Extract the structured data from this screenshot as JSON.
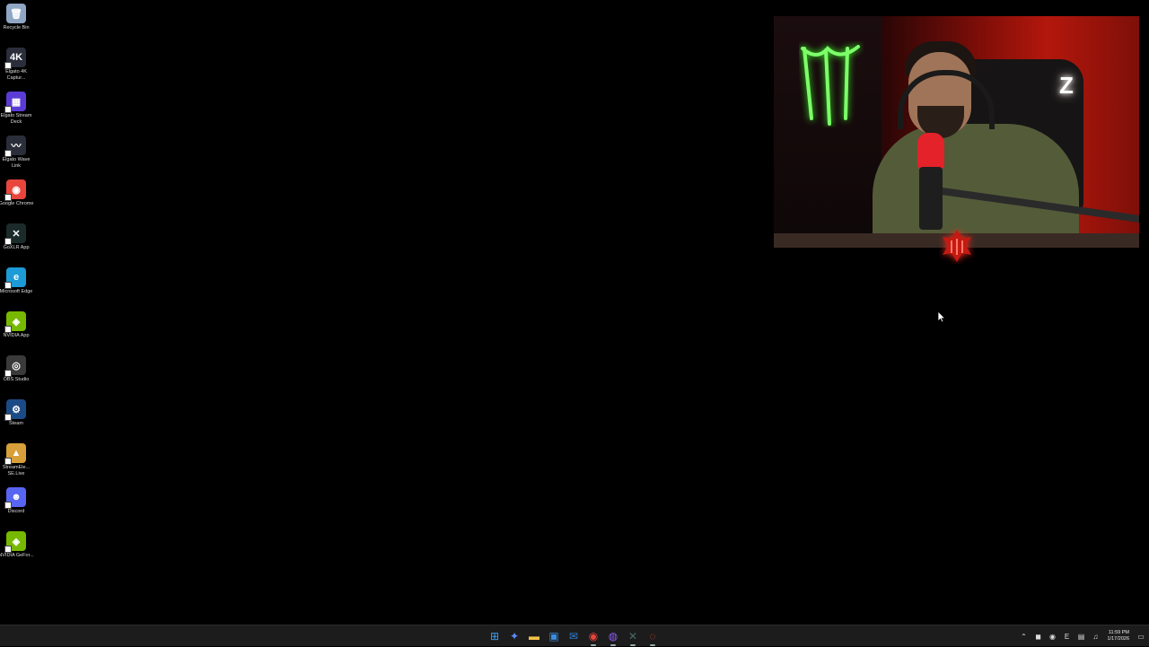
{
  "desktop": {
    "icons": [
      {
        "label": "Recycle Bin",
        "icon": "recycle-bin-icon",
        "color": "#8fa6c4"
      },
      {
        "label": "Elgato 4K Captur...",
        "icon": "elgato-4k-icon",
        "color": "#2a2d3a"
      },
      {
        "label": "Elgato Stream Deck",
        "icon": "stream-deck-icon",
        "color": "#5b3bd6"
      },
      {
        "label": "Elgato Wave Link",
        "icon": "wave-link-icon",
        "color": "#2a2d3a"
      },
      {
        "label": "Google Chrome",
        "icon": "chrome-icon",
        "color": "#e8453c"
      },
      {
        "label": "GoXLR App",
        "icon": "goxlr-icon",
        "color": "#1a2b2a"
      },
      {
        "label": "Microsoft Edge",
        "icon": "edge-icon",
        "color": "#1c9bd6"
      },
      {
        "label": "NVIDIA App",
        "icon": "nvidia-icon",
        "color": "#76b900"
      },
      {
        "label": "OBS Studio",
        "icon": "obs-icon",
        "color": "#3a3a3a"
      },
      {
        "label": "Steam",
        "icon": "steam-icon",
        "color": "#1b4b86"
      },
      {
        "label": "StreamEle... SE.Live",
        "icon": "streamelements-icon",
        "color": "#d8a03a"
      },
      {
        "label": "Discord",
        "icon": "discord-icon",
        "color": "#5865f2"
      },
      {
        "label": "NVIDIA GeFor...",
        "icon": "geforce-icon",
        "color": "#76b900"
      }
    ]
  },
  "taskbar": {
    "apps": [
      {
        "name": "start-button",
        "icon": "windows-start-icon",
        "color": "#3aa0ff"
      },
      {
        "name": "copilot-button",
        "icon": "copilot-icon",
        "color": "#5a8cff"
      },
      {
        "name": "file-explorer-button",
        "icon": "folder-icon",
        "color": "#f3c245"
      },
      {
        "name": "microsoft-store-button",
        "icon": "store-icon",
        "color": "#3a8de0"
      },
      {
        "name": "mail-button",
        "icon": "mail-icon",
        "color": "#2e7fd8"
      },
      {
        "name": "chrome-taskbar-button",
        "icon": "chrome-icon",
        "color": "#e8453c"
      },
      {
        "name": "messenger-taskbar-button",
        "icon": "messenger-icon",
        "color": "#8c5cf6"
      },
      {
        "name": "goxlr-taskbar-button",
        "icon": "goxlr-icon",
        "color": "#4a6a66"
      },
      {
        "name": "streamelements-taskbar-button",
        "icon": "streamelements-icon",
        "color": "#d8453a"
      }
    ],
    "tray": {
      "icons": [
        "chevron-up-icon",
        "network-icon",
        "mic-icon",
        "keyboard-icon",
        "wifi-icon",
        "volume-icon"
      ],
      "time": "11:59 PM",
      "date": "1/17/2026"
    }
  },
  "webcam": {
    "logo_text": "Z"
  }
}
